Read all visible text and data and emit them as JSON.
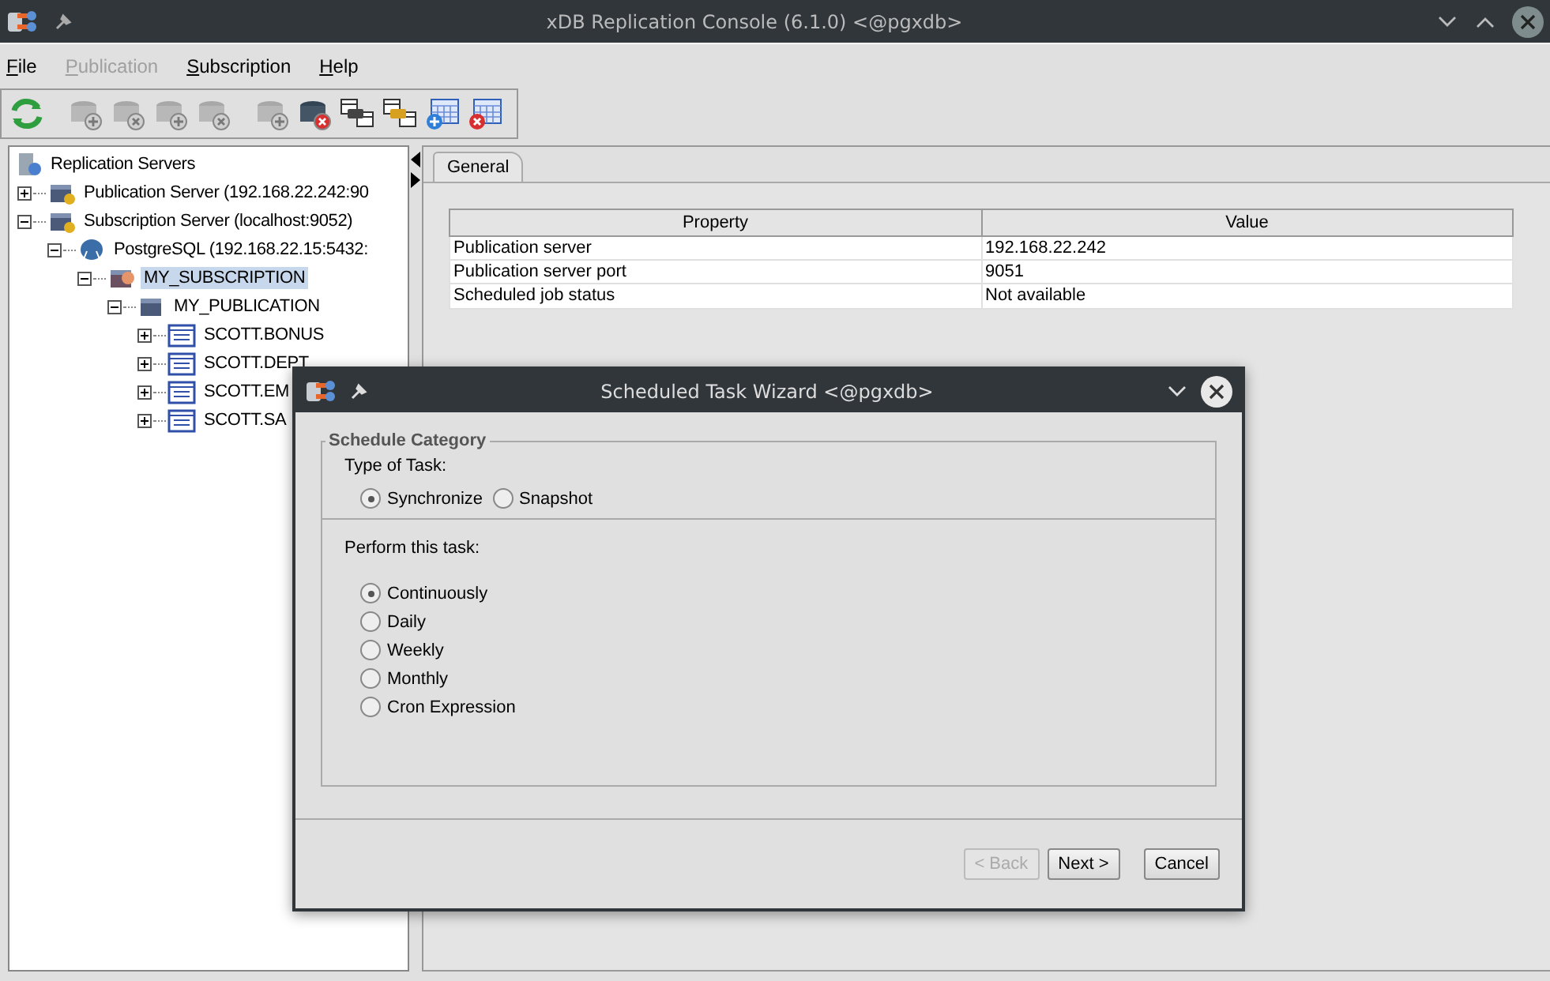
{
  "window": {
    "title": "xDB Replication Console (6.1.0) <@pgxdb>"
  },
  "menu": [
    {
      "label": "File",
      "disabled": false
    },
    {
      "label": "Publication",
      "disabled": true
    },
    {
      "label": "Subscription",
      "disabled": false
    },
    {
      "label": "Help",
      "disabled": false
    }
  ],
  "tree": [
    {
      "label": "Replication Servers",
      "kind": "root",
      "selected": false,
      "children": [
        {
          "label": "Publication Server (192.168.22.242:90",
          "kind": "server",
          "expanded": false,
          "selected": false
        },
        {
          "label": "Subscription Server (localhost:9052)",
          "kind": "server",
          "expanded": true,
          "selected": false,
          "children": [
            {
              "label": "PostgreSQL (192.168.22.15:5432:",
              "kind": "database",
              "expanded": true,
              "selected": false,
              "children": [
                {
                  "label": "MY_SUBSCRIPTION",
                  "kind": "subscription",
                  "expanded": true,
                  "selected": true,
                  "children": [
                    {
                      "label": "MY_PUBLICATION",
                      "kind": "publication",
                      "expanded": true,
                      "selected": false,
                      "children": [
                        {
                          "label": "SCOTT.BONUS",
                          "kind": "table",
                          "expanded": false,
                          "selected": false
                        },
                        {
                          "label": "SCOTT.DEPT",
                          "kind": "table",
                          "expanded": false,
                          "selected": false
                        },
                        {
                          "label": "SCOTT.EM",
                          "kind": "table",
                          "expanded": false,
                          "selected": false
                        },
                        {
                          "label": "SCOTT.SA",
                          "kind": "table",
                          "expanded": false,
                          "selected": false
                        }
                      ]
                    }
                  ]
                }
              ]
            }
          ]
        }
      ]
    }
  ],
  "tabs": [
    {
      "label": "General",
      "selected": true
    }
  ],
  "table": {
    "columns": [
      "Property",
      "Value"
    ],
    "rows": [
      [
        "Publication server",
        "192.168.22.242"
      ],
      [
        "Publication server port",
        "9051"
      ],
      [
        "Scheduled job status",
        "Not available"
      ]
    ]
  },
  "dialog": {
    "title": "Scheduled Task Wizard <@pgxdb>",
    "group": "Schedule Category",
    "type_label": "Type of Task:",
    "types": [
      {
        "label": "Synchronize",
        "selected": true
      },
      {
        "label": "Snapshot",
        "selected": false
      }
    ],
    "perform_label": "Perform this task:",
    "options": [
      {
        "label": "Continuously",
        "selected": true
      },
      {
        "label": "Daily",
        "selected": false
      },
      {
        "label": "Weekly",
        "selected": false
      },
      {
        "label": "Monthly",
        "selected": false
      },
      {
        "label": "Cron Expression",
        "selected": false
      }
    ],
    "buttons": [
      {
        "label": "< Back",
        "disabled": true
      },
      {
        "label": "Next >",
        "disabled": false
      },
      {
        "label": "Cancel",
        "disabled": false
      }
    ]
  }
}
